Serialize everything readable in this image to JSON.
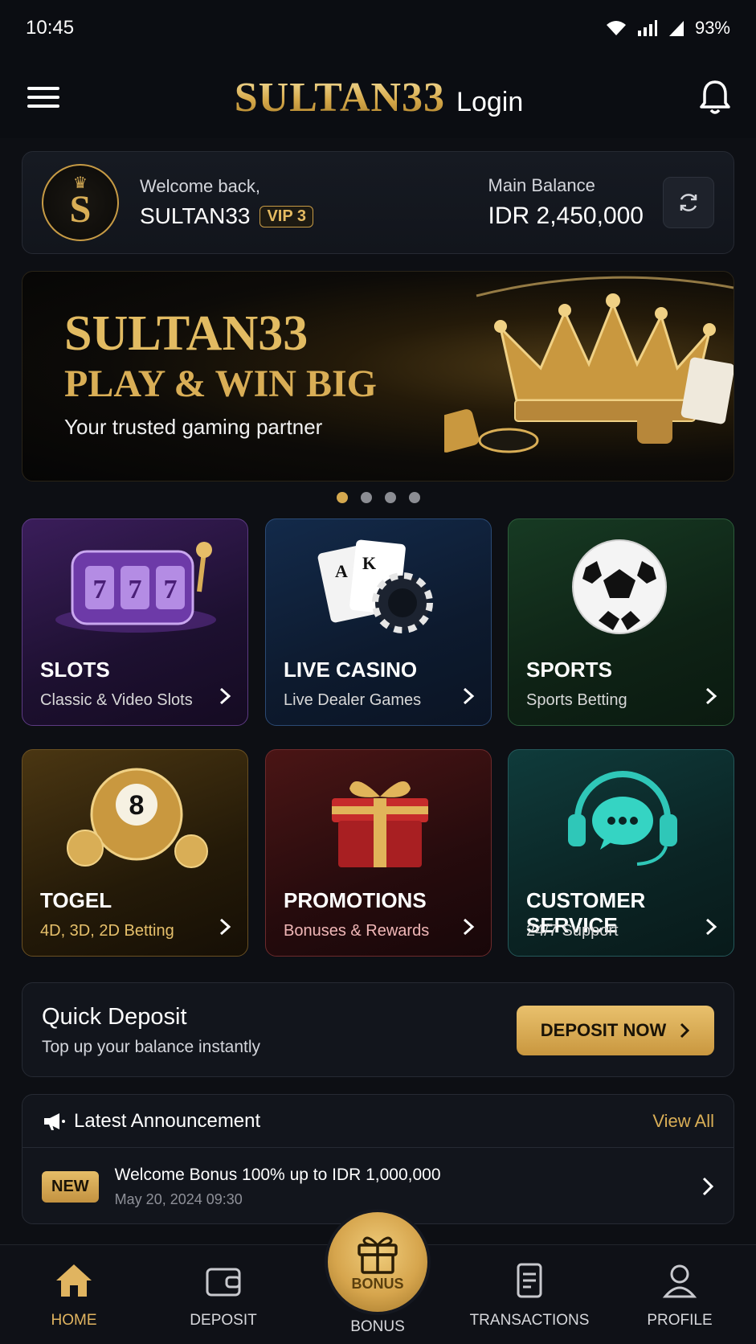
{
  "status_bar": {
    "time": "10:45",
    "battery": "93%"
  },
  "app_bar": {
    "brand": "SULTAN33",
    "login": "Login"
  },
  "welcome": {
    "greeting": "Welcome back,",
    "username": "SULTAN33",
    "vip": "VIP 3",
    "balance_label": "Main Balance",
    "balance_value": "IDR 2,450,000"
  },
  "banner": {
    "title": "SULTAN33",
    "headline": "PLAY & WIN BIG",
    "tagline": "Your trusted gaming partner",
    "slides": 4,
    "active_slide": 1
  },
  "categories": [
    {
      "title": "SLOTS",
      "subtitle": "Classic & Video Slots"
    },
    {
      "title": "LIVE CASINO",
      "subtitle": "Live Dealer Games"
    },
    {
      "title": "SPORTS",
      "subtitle": "Sports Betting"
    },
    {
      "title": "TOGEL",
      "subtitle": "4D, 3D, 2D Betting"
    },
    {
      "title": "PROMOTIONS",
      "subtitle": "Bonuses & Rewards"
    },
    {
      "title": "CUSTOMER SERVICE",
      "subtitle": "24/7 Support"
    }
  ],
  "quick_deposit": {
    "title": "Quick Deposit",
    "subtitle": "Top up your balance instantly",
    "button": "DEPOSIT NOW"
  },
  "announcement": {
    "title": "Latest Announcement",
    "view_all": "View All",
    "badge": "NEW",
    "message": "Welcome Bonus 100% up to IDR 1,000,000",
    "date": "May 20, 2024   09:30"
  },
  "bottom_nav": {
    "home": "HOME",
    "deposit": "DEPOSIT",
    "bonus": "BONUS",
    "bonus_fab_text": "BONUS",
    "transactions": "TRANSACTIONS",
    "profile": "PROFILE"
  },
  "colors": {
    "accent": "#d9ae56",
    "background": "#0d0f14"
  }
}
